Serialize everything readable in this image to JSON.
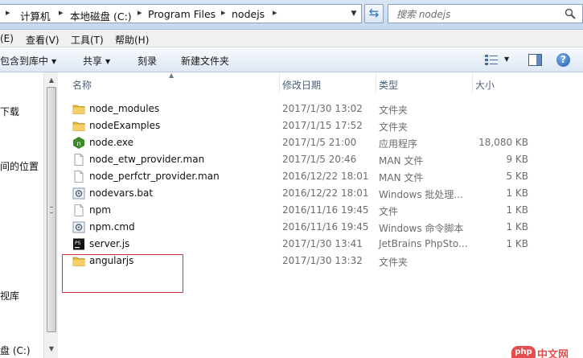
{
  "address_bar": {
    "crumbs": [
      "计算机",
      "本地磁盘 (C:)",
      "Program Files",
      "nodejs"
    ],
    "search_placeholder": "搜索 nodejs"
  },
  "menu": {
    "items": [
      "(E)",
      "查看(V)",
      "工具(T)",
      "帮助(H)"
    ]
  },
  "toolbar": {
    "include_library": "包含到库中",
    "share": "共享",
    "burn": "刻录",
    "new_folder": "新建文件夹"
  },
  "nav": {
    "items": [
      "下载",
      "间的位置",
      "视库",
      "盘 (C:)"
    ]
  },
  "columns": {
    "name": "名称",
    "date": "修改日期",
    "type": "类型",
    "size": "大小"
  },
  "files": [
    {
      "name": "node_modules",
      "date": "2017/1/30 13:02",
      "type": "文件夹",
      "size": "",
      "icon": "folder-icon"
    },
    {
      "name": "nodeExamples",
      "date": "2017/1/15 17:52",
      "type": "文件夹",
      "size": "",
      "icon": "folder-icon"
    },
    {
      "name": "node.exe",
      "date": "2017/1/5 21:00",
      "type": "应用程序",
      "size": "18,080 KB",
      "icon": "node-exe-icon"
    },
    {
      "name": "node_etw_provider.man",
      "date": "2017/1/5 20:46",
      "type": "MAN 文件",
      "size": "9 KB",
      "icon": "file-icon"
    },
    {
      "name": "node_perfctr_provider.man",
      "date": "2016/12/22 18:01",
      "type": "MAN 文件",
      "size": "5 KB",
      "icon": "file-icon"
    },
    {
      "name": "nodevars.bat",
      "date": "2016/12/22 18:01",
      "type": "Windows 批处理...",
      "size": "1 KB",
      "icon": "batch-icon"
    },
    {
      "name": "npm",
      "date": "2016/11/16 19:45",
      "type": "文件",
      "size": "1 KB",
      "icon": "file-icon"
    },
    {
      "name": "npm.cmd",
      "date": "2016/11/16 19:45",
      "type": "Windows 命令脚本",
      "size": "1 KB",
      "icon": "batch-icon"
    },
    {
      "name": "server.js",
      "date": "2017/1/30 13:41",
      "type": "JetBrains PhpSto...",
      "size": "1 KB",
      "icon": "phpstorm-js-icon"
    },
    {
      "name": "angularjs",
      "date": "2017/1/30 13:32",
      "type": "文件夹",
      "size": "",
      "icon": "folder-icon"
    }
  ],
  "watermark": {
    "badge": "php",
    "text": "中文网"
  }
}
